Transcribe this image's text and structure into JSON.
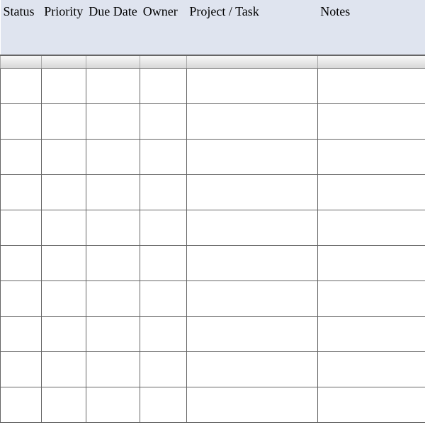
{
  "table": {
    "columns": [
      {
        "label": "Status"
      },
      {
        "label": "Priority"
      },
      {
        "label": "Due Date"
      },
      {
        "label": "Owner"
      },
      {
        "label": "Project / Task"
      },
      {
        "label": "Notes"
      }
    ],
    "rows": [
      {
        "status": "",
        "priority": "",
        "dueDate": "",
        "owner": "",
        "projectTask": "",
        "notes": ""
      },
      {
        "status": "",
        "priority": "",
        "dueDate": "",
        "owner": "",
        "projectTask": "",
        "notes": ""
      },
      {
        "status": "",
        "priority": "",
        "dueDate": "",
        "owner": "",
        "projectTask": "",
        "notes": ""
      },
      {
        "status": "",
        "priority": "",
        "dueDate": "",
        "owner": "",
        "projectTask": "",
        "notes": ""
      },
      {
        "status": "",
        "priority": "",
        "dueDate": "",
        "owner": "",
        "projectTask": "",
        "notes": ""
      },
      {
        "status": "",
        "priority": "",
        "dueDate": "",
        "owner": "",
        "projectTask": "",
        "notes": ""
      },
      {
        "status": "",
        "priority": "",
        "dueDate": "",
        "owner": "",
        "projectTask": "",
        "notes": ""
      },
      {
        "status": "",
        "priority": "",
        "dueDate": "",
        "owner": "",
        "projectTask": "",
        "notes": ""
      },
      {
        "status": "",
        "priority": "",
        "dueDate": "",
        "owner": "",
        "projectTask": "",
        "notes": ""
      },
      {
        "status": "",
        "priority": "",
        "dueDate": "",
        "owner": "",
        "projectTask": "",
        "notes": ""
      }
    ]
  }
}
